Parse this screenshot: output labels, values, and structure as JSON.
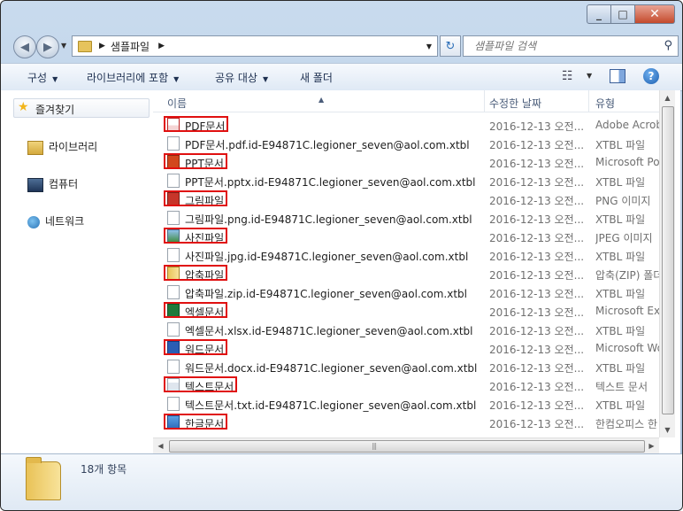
{
  "window": {
    "minimize": "_",
    "maximize": "□",
    "close": "✕"
  },
  "address": {
    "path": "샘플파일",
    "refresh": "↻"
  },
  "search": {
    "placeholder": "샘플파일 검색"
  },
  "toolbar": {
    "organize": "구성",
    "include_library": "라이브러리에 포함",
    "share": "공유 대상",
    "new_folder": "새 폴더",
    "help": "?"
  },
  "nav": {
    "favorites": "즐겨찾기",
    "libraries": "라이브러리",
    "computer": "컴퓨터",
    "network": "네트워크"
  },
  "columns": {
    "name": "이름",
    "date": "수정한 날짜",
    "type": "유형"
  },
  "files": [
    {
      "name": "PDF문서",
      "date": "2016-12-13 오전...",
      "type": "Adobe Acrob",
      "icon": "pdf-icon",
      "highlighted": true
    },
    {
      "name": "PDF문서.pdf.id-E94871C.legioner_seven@aol.com.xtbl",
      "date": "2016-12-13 오전...",
      "type": "XTBL 파일",
      "icon": "file-icon",
      "highlighted": false
    },
    {
      "name": "PPT문서",
      "date": "2016-12-13 오전...",
      "type": "Microsoft Po",
      "icon": "ppt-icon",
      "highlighted": true
    },
    {
      "name": "PPT문서.pptx.id-E94871C.legioner_seven@aol.com.xtbl",
      "date": "2016-12-13 오전...",
      "type": "XTBL 파일",
      "icon": "file-icon",
      "highlighted": false
    },
    {
      "name": "그림파일",
      "date": "2016-12-13 오전...",
      "type": "PNG 이미지",
      "icon": "png-icon",
      "highlighted": true
    },
    {
      "name": "그림파일.png.id-E94871C.legioner_seven@aol.com.xtbl",
      "date": "2016-12-13 오전...",
      "type": "XTBL 파일",
      "icon": "file-icon",
      "highlighted": false
    },
    {
      "name": "사진파일",
      "date": "2016-12-13 오전...",
      "type": "JPEG 이미지",
      "icon": "jpg-icon",
      "highlighted": true
    },
    {
      "name": "사진파일.jpg.id-E94871C.legioner_seven@aol.com.xtbl",
      "date": "2016-12-13 오전...",
      "type": "XTBL 파일",
      "icon": "file-icon",
      "highlighted": false
    },
    {
      "name": "압축파일",
      "date": "2016-12-13 오전...",
      "type": "압축(ZIP) 폴더",
      "icon": "zip-icon",
      "highlighted": true
    },
    {
      "name": "압축파일.zip.id-E94871C.legioner_seven@aol.com.xtbl",
      "date": "2016-12-13 오전...",
      "type": "XTBL 파일",
      "icon": "file-icon",
      "highlighted": false
    },
    {
      "name": "엑셀문서",
      "date": "2016-12-13 오전...",
      "type": "Microsoft Exc",
      "icon": "excel-icon",
      "highlighted": true
    },
    {
      "name": "엑셀문서.xlsx.id-E94871C.legioner_seven@aol.com.xtbl",
      "date": "2016-12-13 오전...",
      "type": "XTBL 파일",
      "icon": "file-icon",
      "highlighted": false
    },
    {
      "name": "워드문서",
      "date": "2016-12-13 오전...",
      "type": "Microsoft Wo",
      "icon": "word-icon",
      "highlighted": true
    },
    {
      "name": "워드문서.docx.id-E94871C.legioner_seven@aol.com.xtbl",
      "date": "2016-12-13 오전...",
      "type": "XTBL 파일",
      "icon": "file-icon",
      "highlighted": false
    },
    {
      "name": "텍스트문서",
      "date": "2016-12-13 오전...",
      "type": "텍스트 문서",
      "icon": "text-icon",
      "highlighted": true
    },
    {
      "name": "텍스트문서.txt.id-E94871C.legioner_seven@aol.com.xtbl",
      "date": "2016-12-13 오전...",
      "type": "XTBL 파일",
      "icon": "file-icon",
      "highlighted": false
    },
    {
      "name": "한글문서",
      "date": "2016-12-13 오전...",
      "type": "한컴오피스 한",
      "icon": "hwp-icon",
      "highlighted": true
    }
  ],
  "details": {
    "item_count": "18개 항목"
  },
  "colors": {
    "highlight_border": "#e01010",
    "window_frame": "#a9c1dc"
  }
}
